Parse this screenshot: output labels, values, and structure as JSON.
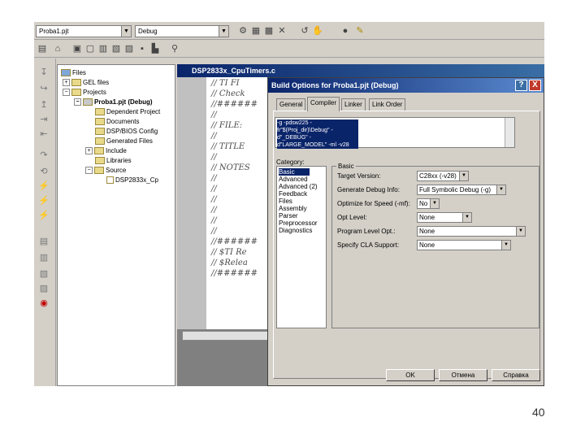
{
  "toolbar": {
    "project_combo": "Proba1.pjt",
    "config_combo": "Debug",
    "icons": [
      "compile-icon",
      "build-icon",
      "rebuild-icon",
      "stop-build-icon",
      "step-icon",
      "breakpoint-icon",
      "halt-icon",
      "gel-icon",
      "new-icon",
      "open-icon",
      "save-icon",
      "cut-icon",
      "copy-icon",
      "paste-icon",
      "print-icon",
      "find-icon"
    ]
  },
  "tree": {
    "items": [
      {
        "label": "Files"
      },
      {
        "label": "GEL files"
      },
      {
        "label": "Projects"
      },
      {
        "label": "Proba1.pjt (Debug)"
      },
      {
        "label": "Dependent Project"
      },
      {
        "label": "Documents"
      },
      {
        "label": "DSP/BIOS Config"
      },
      {
        "label": "Generated Files"
      },
      {
        "label": "Include"
      },
      {
        "label": "Libraries"
      },
      {
        "label": "Source"
      },
      {
        "label": "DSP2833x_Cp"
      }
    ]
  },
  "editor": {
    "title": "DSP2833x_CpuTimers.c",
    "lines": [
      "// TI FI",
      "// Check",
      "//######",
      "//",
      "// FILE:",
      "//",
      "// TITLE",
      "//",
      "// NOTES",
      "//",
      "//",
      "//",
      "//",
      "//",
      "//",
      "//######",
      "// $TI Re",
      "// $Relea",
      "//######"
    ]
  },
  "dialog": {
    "title": "Build Options for Proba1.pjt (Debug)",
    "help_btn": "?",
    "close_btn": "X",
    "tabs": [
      "General",
      "Compiler",
      "Linker",
      "Link Order"
    ],
    "options_text": "-g -pdsw225 -fr\"$(Proj_dir)\\Debug\" -d\"_DEBUG\" -d\"LARGE_MODEL\" -ml -v28",
    "category_label": "Category:",
    "categories": [
      "Basic",
      "Advanced",
      "Advanced (2)",
      "Feedback",
      "Files",
      "Assembly",
      "Parser",
      "Preprocessor",
      "Diagnostics"
    ],
    "basic_label": "Basic",
    "fields": [
      {
        "label": "Target Version:",
        "value": "C28xx (-v28)"
      },
      {
        "label": "Generate Debug Info:",
        "value": "Full Symbolic Debug (-g)"
      },
      {
        "label": "Optimize for Speed (-mf):",
        "value": "No"
      },
      {
        "label": "Opt Level:",
        "value": "None"
      },
      {
        "label": "Program Level Opt.:",
        "value": "None"
      },
      {
        "label": "Specify CLA Support:",
        "value": "None"
      }
    ],
    "buttons": {
      "ok": "OK",
      "cancel": "Отмена",
      "help": "Справка"
    }
  },
  "page_number": "40"
}
